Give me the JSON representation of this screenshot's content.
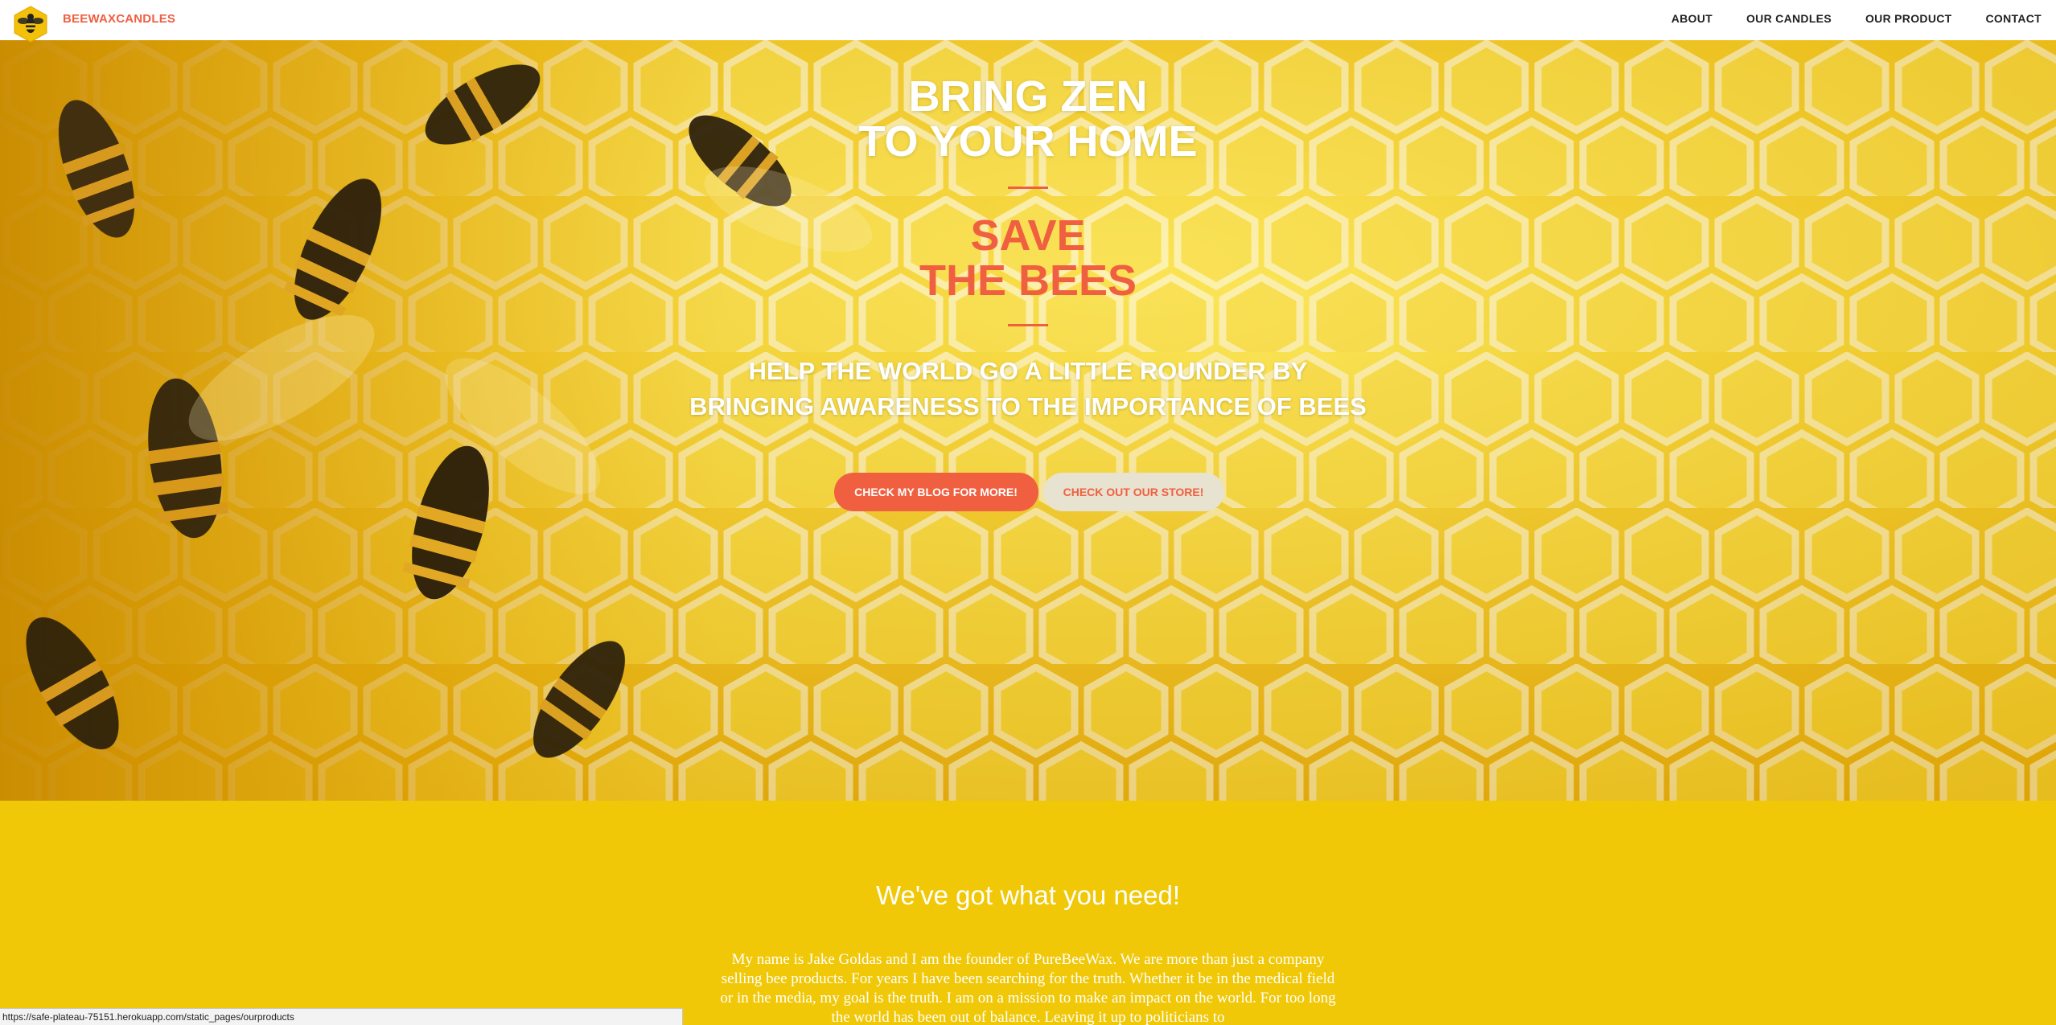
{
  "navbar": {
    "brand": "BEEWAXCANDLES",
    "links": [
      "ABOUT",
      "OUR CANDLES",
      "OUR PRODUCT",
      "CONTACT"
    ]
  },
  "hero": {
    "title_line1": "BRING ZEN",
    "title_line2": "TO YOUR HOME",
    "subtitle_line1": "SAVE",
    "subtitle_line2": "THE BEES",
    "tagline_line1": "HELP THE WORLD GO A LITTLE ROUNDER BY",
    "tagline_line2": "BRINGING AWARENESS TO THE IMPORTANCE OF BEES",
    "primary_button": "CHECK MY BLOG FOR MORE!",
    "secondary_button": "CHECK OUT OUR STORE!"
  },
  "about": {
    "heading": "We've got what you need!",
    "text": "My name is Jake Goldas and I am the founder of PureBeeWax. We are more than just a company selling bee products. For years I have been searching for the truth. Whether it be in the medical field or in the media, my goal is the truth. I am on a mission to make an impact on the world. For too long the world has been out of balance. Leaving it up to politicians to"
  },
  "status_bar": {
    "url": "https://safe-plateau-75151.herokuapp.com/static_pages/ourproducts"
  },
  "colors": {
    "accent": "#f05f40",
    "section_background": "#f0c808",
    "navbar_background": "#ffffff"
  },
  "icons": {
    "brand_logo": "bee-hexagon-icon"
  }
}
